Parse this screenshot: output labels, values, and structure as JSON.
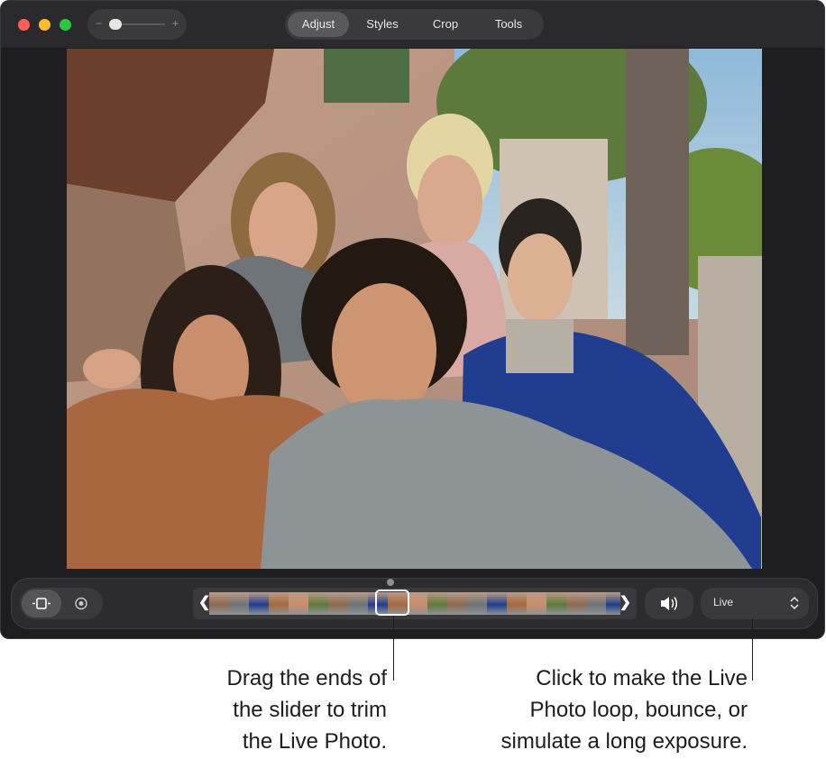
{
  "window": {
    "zoom": {
      "minus": "−",
      "plus": "+"
    },
    "tabs": [
      "Adjust",
      "Styles",
      "Crop",
      "Tools"
    ],
    "active_tab": "Adjust"
  },
  "photo": {
    "description_icon": "group-selfie-photo"
  },
  "bottom_bar": {
    "trim_left_arrow": "❮",
    "trim_right_arrow": "❯",
    "live_select_value": "Live",
    "icons": [
      "live-photo-trim-icon",
      "live-photo-badge-icon",
      "speaker-icon",
      "up-down-chevron-icon"
    ]
  },
  "callouts": {
    "trim": [
      "Drag the ends of",
      "the slider to trim",
      "the Live Photo."
    ],
    "live": [
      "Click to make the Live",
      "Photo loop, bounce, or",
      "simulate a long exposure."
    ]
  },
  "colors": {
    "window_bg": "#1e1e20",
    "toolbar_bg": "#2a2a2c",
    "close": "#ff5f57",
    "minimize": "#febc2e",
    "maximize": "#28c840"
  }
}
